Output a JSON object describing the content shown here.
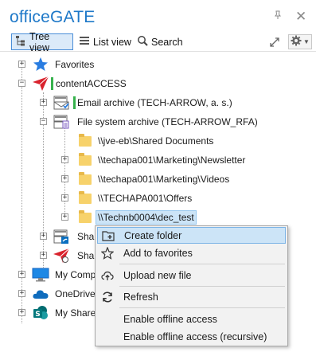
{
  "app": {
    "title": "officeGATE"
  },
  "toolbar": {
    "tree_view": "Tree view",
    "list_view": "List view",
    "search": "Search"
  },
  "tree": {
    "favorites": "Favorites",
    "content_access": "contentACCESS",
    "email_archive": "Email archive (TECH-ARROW, a. s.)",
    "fs_archive": "File system archive (TECH-ARROW_RFA)",
    "folders": [
      "\\\\jve-eb\\Shared Documents",
      "\\\\techapa001\\Marketing\\Newsletter",
      "\\\\techapa001\\Marketing\\Videos",
      "\\\\TECHAPA001\\Offers",
      "\\\\Technb0004\\dec_test"
    ],
    "share1": "Share",
    "share2": "Share",
    "my_computer": "My Comp",
    "onedrive": "OneDrive",
    "my_sharepoint": "My Sharel"
  },
  "context_menu": {
    "create_folder": "Create folder",
    "add_favorites": "Add to favorites",
    "upload_file": "Upload new file",
    "refresh": "Refresh",
    "offline": "Enable offline access",
    "offline_recursive": "Enable offline access (recursive)"
  },
  "colors": {
    "brand": "#1e78c8",
    "selection": "#cce4f7",
    "folder": "#f7d26b",
    "accent": "#37b24d"
  }
}
